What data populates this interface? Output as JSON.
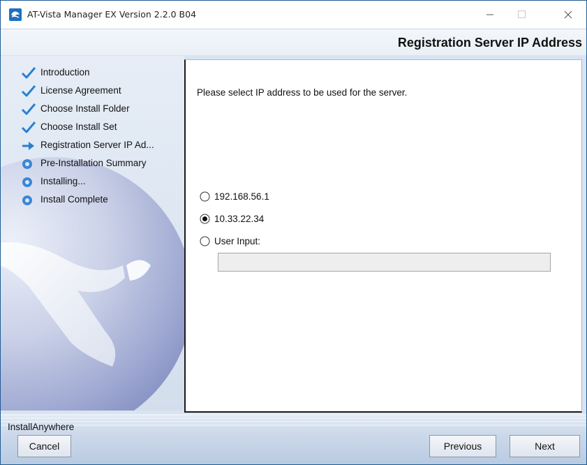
{
  "window": {
    "title": "AT-Vista Manager EX Version 2.2.0 B04",
    "minimize_icon": "minimize-icon",
    "maximize_icon": "maximize-icon",
    "close_icon": "close-icon"
  },
  "header": {
    "title": "Registration Server IP Address"
  },
  "steps": [
    {
      "label": "Introduction",
      "status": "done",
      "icon": "checkmark-icon"
    },
    {
      "label": "License Agreement",
      "status": "done",
      "icon": "checkmark-icon"
    },
    {
      "label": "Choose Install Folder",
      "status": "done",
      "icon": "checkmark-icon"
    },
    {
      "label": "Choose Install Set",
      "status": "done",
      "icon": "checkmark-icon"
    },
    {
      "label": "Registration Server IP Ad...",
      "status": "current",
      "icon": "arrow-right-icon"
    },
    {
      "label": "Pre-Installation Summary",
      "status": "pending",
      "icon": "bullet-icon"
    },
    {
      "label": "Installing...",
      "status": "pending",
      "icon": "bullet-icon"
    },
    {
      "label": "Install Complete",
      "status": "pending",
      "icon": "bullet-icon"
    }
  ],
  "main": {
    "prompt": "Please select IP address to be used for the server.",
    "options": [
      {
        "label": "192.168.56.1",
        "selected": false
      },
      {
        "label": "10.33.22.34",
        "selected": true
      },
      {
        "label": "User Input:",
        "selected": false
      }
    ],
    "user_input_value": ""
  },
  "footer": {
    "brand": "InstallAnywhere",
    "cancel_label": "Cancel",
    "previous_label": "Previous",
    "next_label": "Next"
  },
  "colors": {
    "check": "#2a7fd0",
    "arrow": "#2a7fd0",
    "bullet": "#3b86d6",
    "header_text": "#111111"
  }
}
